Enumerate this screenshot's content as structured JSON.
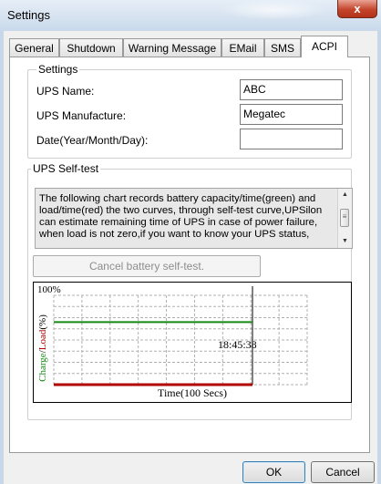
{
  "window": {
    "title": "Settings",
    "close_glyph": "x"
  },
  "tabs": [
    "General",
    "Shutdown",
    "Warning Message",
    "EMail",
    "SMS",
    "ACPI"
  ],
  "active_tab": "ACPI",
  "settings_group": {
    "legend": "Settings",
    "fields": [
      {
        "label": "UPS Name:",
        "value": "ABC"
      },
      {
        "label": "UPS Manufacture:",
        "value": "Megatec"
      },
      {
        "label": "Date(Year/Month/Day):",
        "value": ""
      }
    ]
  },
  "selftest_group": {
    "legend": "UPS Self-test",
    "description": "The following chart records battery capacity/time(green) and load/time(red) the two curves, through self-test curve,UPSilon can estimate remaining time of UPS in case of power failure, when load is not zero,if you want to know your UPS status,",
    "cancel_button": "Cancel battery self-test."
  },
  "chart_data": {
    "type": "line",
    "top_label": "100%",
    "ylabel_charge": "Charge",
    "ylabel_separator": "/",
    "ylabel_load": "Load",
    "ylabel_unit": "(%)",
    "xlabel": "Time(100 Secs)",
    "time_marker": "18:45:38",
    "ylim": [
      0,
      100
    ],
    "grid": true,
    "series": [
      {
        "name": "Charge",
        "color": "#138a13",
        "values": [
          70,
          70
        ]
      },
      {
        "name": "Load",
        "color": "#b00000",
        "values": [
          0,
          0
        ]
      }
    ]
  },
  "footer": {
    "ok_label": "OK",
    "cancel_label": "Cancel"
  },
  "icons": {
    "scroll_up": "▲",
    "scroll_down": "▼",
    "scroll_grip": "≡"
  }
}
